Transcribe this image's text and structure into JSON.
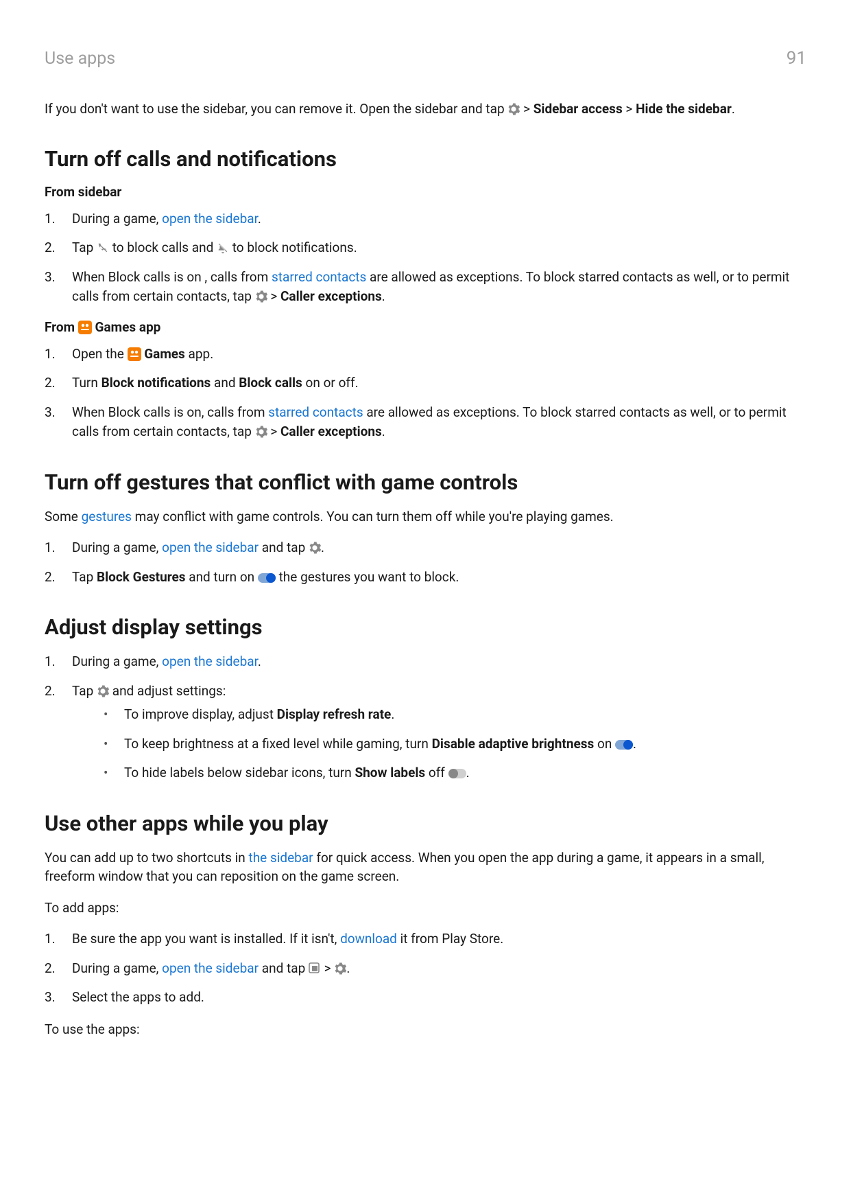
{
  "header": {
    "left": "Use apps",
    "right": "91"
  },
  "intro": {
    "pre": "If you don't want to use the sidebar, you can remove it. Open the sidebar and tap ",
    "arrow1": " > ",
    "sidebar_access": "Sidebar access",
    "arrow2": " > ",
    "hide": "Hide the sidebar",
    "period": "."
  },
  "sec1": {
    "title": "Turn off calls and notifications",
    "from_sidebar": "From sidebar",
    "s1_pre": "During a game, ",
    "s1_link": "open the sidebar",
    "s1_post": ".",
    "s2_pre": "Tap ",
    "s2_mid1": " to block calls and ",
    "s2_mid2": " to block notifications.",
    "s3_pre": "When Block calls is on ",
    "s3_a": ", calls from ",
    "s3_link": "starred contacts",
    "s3_b": " are allowed as exceptions. To block starred contacts as well, or to permit calls from certain contacts, tap ",
    "s3_arrow": " > ",
    "s3_ce": "Caller exceptions",
    "s3_post": ".",
    "from_games_pre": "From ",
    "from_games_post": " Games app",
    "g1_pre": "Open the ",
    "g1_bold": "Games",
    "g1_post": " app.",
    "g2_pre": "Turn ",
    "g2_b1": "Block notifications",
    "g2_and": " and ",
    "g2_b2": "Block calls",
    "g2_post": " on or off.",
    "g3_pre": "When Block calls is on, calls from ",
    "g3_link": "starred contacts",
    "g3_mid": " are allowed as exceptions. To block starred contacts as well, or to permit calls from certain contacts, tap ",
    "g3_arrow": " > ",
    "g3_ce": "Caller exceptions",
    "g3_post": "."
  },
  "sec2": {
    "title": "Turn off gestures that conflict with game controls",
    "intro_pre": "Some ",
    "intro_link": "gestures",
    "intro_post": " may conflict with game controls. You can turn them off while you're playing games.",
    "s1_pre": "During a game, ",
    "s1_link": "open the sidebar",
    "s1_mid": " and tap ",
    "s1_post": ".",
    "s2_pre": "Tap ",
    "s2_b": "Block Gestures",
    "s2_mid": " and turn on ",
    "s2_post": " the gestures you want to block."
  },
  "sec3": {
    "title": "Adjust display settings",
    "s1_pre": "During a game, ",
    "s1_link": "open the sidebar",
    "s1_post": ".",
    "s2_pre": "Tap ",
    "s2_post": " and adjust settings:",
    "b1_pre": "To improve display, adjust ",
    "b1_b": "Display refresh rate",
    "b1_post": ".",
    "b2_pre": "To keep brightness at a fixed level while gaming, turn ",
    "b2_b": "Disable adaptive brightness",
    "b2_mid": " on ",
    "b2_post": ".",
    "b3_pre": "To hide labels below sidebar icons, turn ",
    "b3_b": "Show labels",
    "b3_mid": " off ",
    "b3_post": "."
  },
  "sec4": {
    "title": "Use other apps while you play",
    "p1_pre": "You can add up to two shortcuts in ",
    "p1_link": "the sidebar",
    "p1_post": " for quick access. When you open the app during a game, it appears in a small, freeform window that you can reposition on the game screen.",
    "p2": "To add apps:",
    "s1_pre": "Be sure the app you want is installed. If it isn't, ",
    "s1_link": "download",
    "s1_post": " it from Play Store.",
    "s2_pre": "During a game, ",
    "s2_link": "open the sidebar",
    "s2_mid": " and tap ",
    "s2_arrow": " > ",
    "s2_post": ".",
    "s3": "Select the apps to add.",
    "p3": "To use the apps:"
  },
  "nums": {
    "n1": "1.",
    "n2": "2.",
    "n3": "3."
  }
}
